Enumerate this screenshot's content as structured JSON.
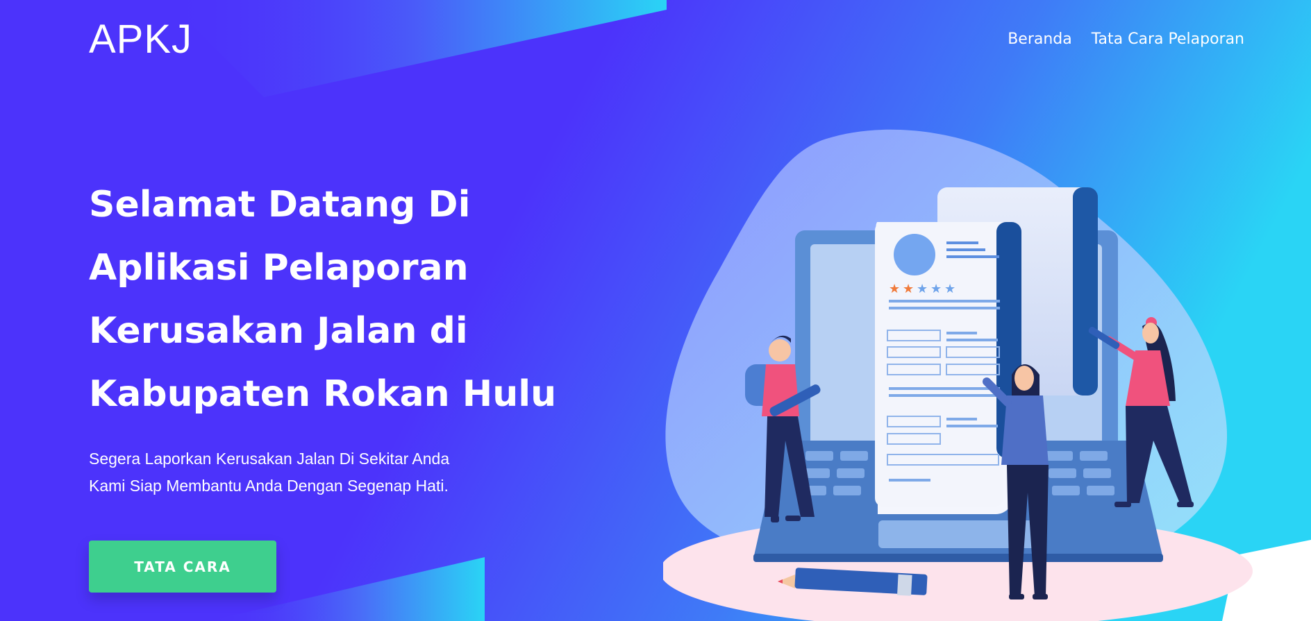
{
  "brand": {
    "name": "APKJ"
  },
  "nav": {
    "items": [
      {
        "label": "Beranda"
      },
      {
        "label": "Tata Cara Pelaporan"
      }
    ]
  },
  "hero": {
    "title": "Selamat Datang Di Aplikasi Pelaporan Kerusakan Jalan di Kabupaten Rokan Hulu",
    "subtitle_lines": [
      "Segera Laporkan Kerusakan Jalan Di Sekitar Anda",
      "Kami Siap Membantu Anda Dengan Segenap Hati."
    ],
    "cta_label": "TATA CARA"
  },
  "colors": {
    "primary": "#4c33fb",
    "gradient_end": "#2ad4f5",
    "button": "#3ecf8e",
    "text": "#ffffff"
  }
}
